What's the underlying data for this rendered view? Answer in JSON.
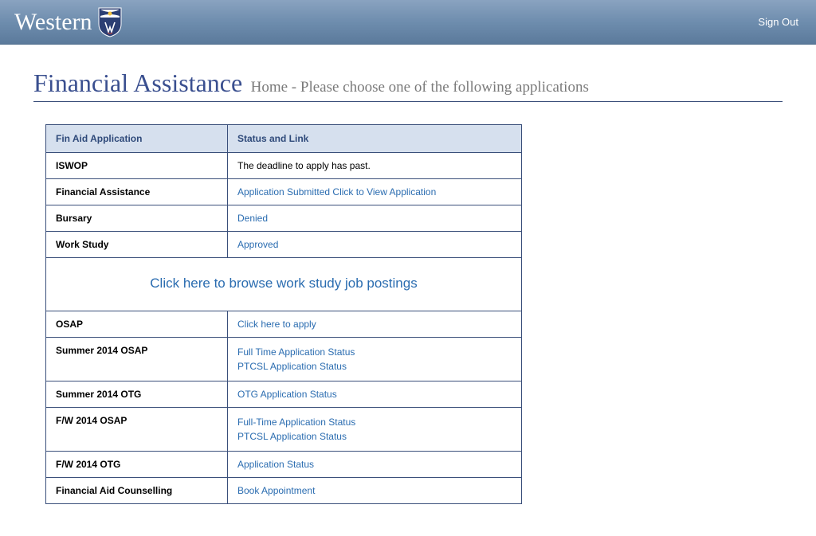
{
  "header": {
    "brand": "Western",
    "signout": "Sign Out"
  },
  "page": {
    "title": "Financial Assistance",
    "subtitle": "Home - Please choose one of the following applications"
  },
  "table": {
    "col1": "Fin Aid Application",
    "col2": "Status and Link",
    "banner": "Click here to browse work study job postings",
    "rows": [
      {
        "label": "ISWOP",
        "type": "text",
        "text": "The deadline to apply has past."
      },
      {
        "label": "Financial Assistance",
        "type": "link",
        "links": [
          "Application Submitted Click to View Application"
        ]
      },
      {
        "label": "Bursary",
        "type": "link",
        "links": [
          "Denied"
        ]
      },
      {
        "label": "Work Study",
        "type": "link",
        "links": [
          "Approved"
        ]
      }
    ],
    "rows2": [
      {
        "label": "OSAP",
        "type": "link",
        "links": [
          "Click here to apply"
        ]
      },
      {
        "label": "Summer 2014 OSAP",
        "type": "link",
        "links": [
          "Full Time Application Status",
          "PTCSL Application Status"
        ]
      },
      {
        "label": "Summer 2014 OTG",
        "type": "link",
        "links": [
          "OTG Application Status"
        ]
      },
      {
        "label": "F/W 2014 OSAP",
        "type": "link",
        "links": [
          "Full-Time Application Status",
          "PTCSL Application Status"
        ]
      },
      {
        "label": "F/W 2014 OTG",
        "type": "link",
        "links": [
          "Application Status"
        ]
      },
      {
        "label": "Financial Aid Counselling",
        "type": "link",
        "links": [
          "Book Appointment"
        ]
      }
    ]
  }
}
